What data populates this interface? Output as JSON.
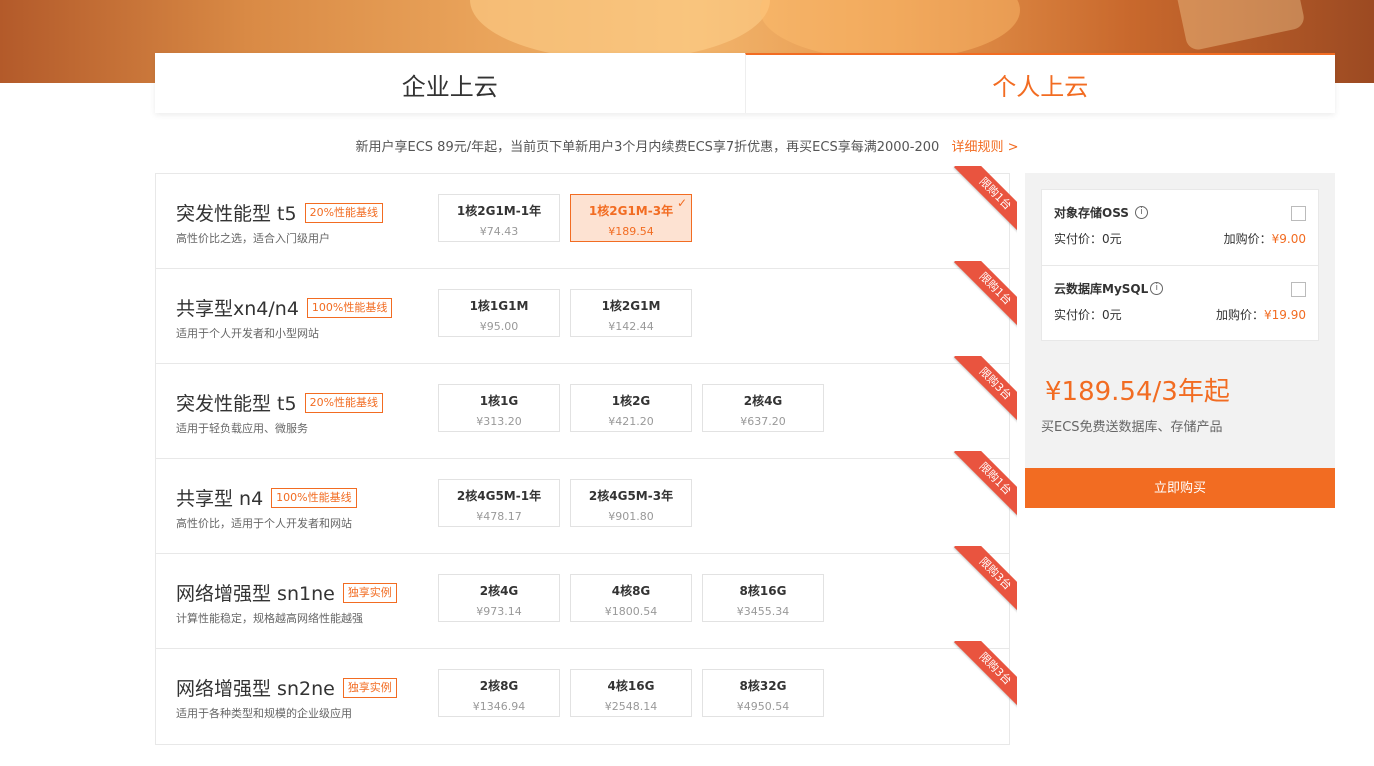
{
  "tabs": [
    {
      "label": "企业上云",
      "active": false
    },
    {
      "label": "个人上云",
      "active": true
    }
  ],
  "promo": {
    "text": "新用户享ECS 89元/年起，当前页下单新用户3个月内续费ECS享7折优惠，再买ECS享每满2000-200",
    "link": "详细规则 >"
  },
  "products": [
    {
      "name": "突发性能型 t5",
      "tag": "20%性能基线",
      "desc": "高性价比之选，适合入门级用户",
      "ribbon": "限购1台",
      "options": [
        {
          "spec": "1核2G1M-1年",
          "price": "¥74.43",
          "selected": false
        },
        {
          "spec": "1核2G1M-3年",
          "price": "¥189.54",
          "selected": true
        }
      ]
    },
    {
      "name": "共享型xn4/n4",
      "tag": "100%性能基线",
      "desc": "适用于个人开发者和小型网站",
      "ribbon": "限购1台",
      "options": [
        {
          "spec": "1核1G1M",
          "price": "¥95.00",
          "selected": false
        },
        {
          "spec": "1核2G1M",
          "price": "¥142.44",
          "selected": false
        }
      ]
    },
    {
      "name": "突发性能型 t5",
      "tag": "20%性能基线",
      "desc": "适用于轻负载应用、微服务",
      "ribbon": "限购3台",
      "options": [
        {
          "spec": "1核1G",
          "price": "¥313.20",
          "selected": false
        },
        {
          "spec": "1核2G",
          "price": "¥421.20",
          "selected": false
        },
        {
          "spec": "2核4G",
          "price": "¥637.20",
          "selected": false
        }
      ]
    },
    {
      "name": "共享型 n4",
      "tag": "100%性能基线",
      "desc": "高性价比，适用于个人开发者和网站",
      "ribbon": "限购1台",
      "options": [
        {
          "spec": "2核4G5M-1年",
          "price": "¥478.17",
          "selected": false
        },
        {
          "spec": "2核4G5M-3年",
          "price": "¥901.80",
          "selected": false
        }
      ]
    },
    {
      "name": "网络增强型 sn1ne",
      "tag": "独享实例",
      "desc": "计算性能稳定，规格越高网络性能越强",
      "ribbon": "限购3台",
      "options": [
        {
          "spec": "2核4G",
          "price": "¥973.14",
          "selected": false
        },
        {
          "spec": "4核8G",
          "price": "¥1800.54",
          "selected": false
        },
        {
          "spec": "8核16G",
          "price": "¥3455.34",
          "selected": false
        }
      ]
    },
    {
      "name": "网络增强型 sn2ne",
      "tag": "独享实例",
      "desc": "适用于各种类型和规模的企业级应用",
      "ribbon": "限购3台",
      "options": [
        {
          "spec": "2核8G",
          "price": "¥1346.94",
          "selected": false
        },
        {
          "spec": "4核16G",
          "price": "¥2548.14",
          "selected": false
        },
        {
          "spec": "8核32G",
          "price": "¥4950.54",
          "selected": false
        }
      ]
    }
  ],
  "addons": [
    {
      "title": "对象存储OSS",
      "paid": "实付价：0元",
      "add_price_label": "加购价：",
      "add_price": "¥9.00",
      "checked": false
    },
    {
      "title": "云数据库MySQL",
      "paid": "实付价：0元",
      "add_price_label": "加购价：",
      "add_price": "¥19.90",
      "checked": false
    }
  ],
  "summary": {
    "total": "¥189.54/3年起",
    "note": "买ECS免费送数据库、存储产品",
    "buy_label": "立即购买"
  },
  "colors": {
    "accent": "#f26c22",
    "ribbon": "#e9543f",
    "selected_bg": "#fde2d2"
  },
  "icons": {
    "check": "check-icon",
    "info": "info-icon"
  }
}
